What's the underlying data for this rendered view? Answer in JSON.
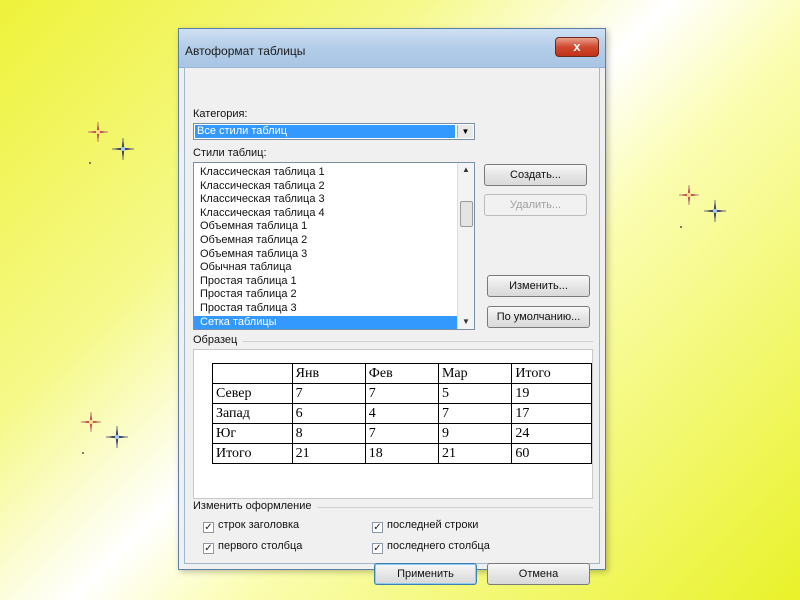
{
  "dialog": {
    "title": "Автоформат таблицы",
    "close_label": "x",
    "category_label": "Категория:",
    "category_value": "Все стили таблиц",
    "styles_label": "Стили таблиц:",
    "styles": [
      "Классическая таблица 1",
      "Классическая таблица 2",
      "Классическая таблица 3",
      "Классическая таблица 4",
      "Объемная таблица 1",
      "Объемная таблица 2",
      "Объемная таблица 3",
      "Обычная таблица",
      "Простая таблица 1",
      "Простая таблица 2",
      "Простая таблица 3",
      "Сетка таблицы"
    ],
    "selected_style_index": 11,
    "buttons": {
      "create": "Создать...",
      "delete": "Удалить...",
      "modify": "Изменить...",
      "default": "По умолчанию...",
      "apply": "Применить",
      "cancel": "Отмена"
    },
    "preview_label": "Образец",
    "preview_table": {
      "header": [
        "",
        "Янв",
        "Фев",
        "Мар",
        "Итого"
      ],
      "rows": [
        [
          "Север",
          "7",
          "7",
          "5",
          "19"
        ],
        [
          "Запад",
          "6",
          "4",
          "7",
          "17"
        ],
        [
          "Юг",
          "8",
          "7",
          "9",
          "24"
        ],
        [
          "Итого",
          "21",
          "18",
          "21",
          "60"
        ]
      ]
    },
    "format_label": "Изменить оформление",
    "options": {
      "header_rows": {
        "label": "строк заголовка",
        "checked": true
      },
      "first_column": {
        "label": "первого столбца",
        "checked": true
      },
      "last_row": {
        "label": "последней строки",
        "checked": true
      },
      "last_column": {
        "label": "последнего столбца",
        "checked": true
      }
    }
  },
  "colors": {
    "background_yellow": "#eef23a",
    "selection": "#3399ff",
    "close_button": "#c0321a"
  }
}
